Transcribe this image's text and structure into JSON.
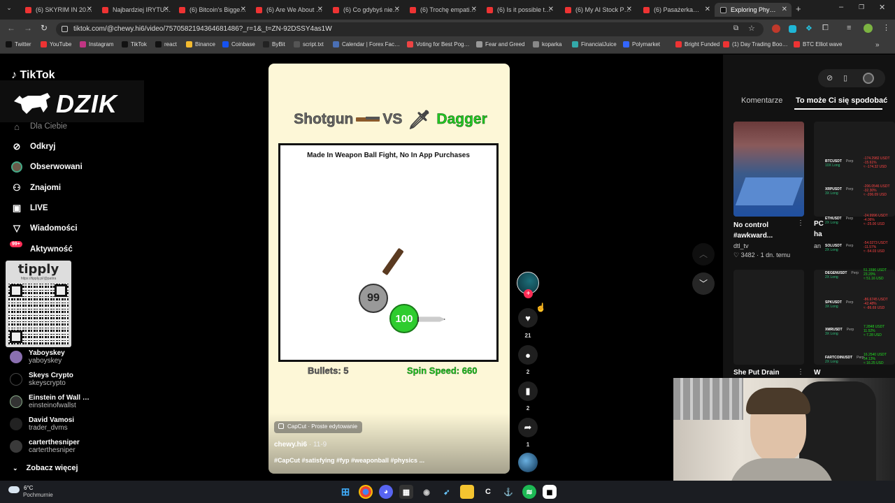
{
  "browser": {
    "tabs": [
      {
        "label": "(6) SKYRIM IN 20…"
      },
      {
        "label": "Najbardziej IRYTU…"
      },
      {
        "label": "(6) Bitcoin's Bigge…"
      },
      {
        "label": "(6) Are We About …"
      },
      {
        "label": "(6) Co gdybyś nie…"
      },
      {
        "label": "(6) Trochę empati…"
      },
      {
        "label": "(6) Is it possible t…"
      },
      {
        "label": "(6) My AI Stock P…"
      },
      {
        "label": "(6) Pasażerka…"
      },
      {
        "label": "Exploring Phy…"
      }
    ],
    "url": "tiktok.com/@chewy.hi6/video/7570582194364681486?_r=1&_t=ZN-92DSSY4as1W",
    "bookmarks": [
      "Twitter",
      "YouTube",
      "Instagram",
      "TikTok",
      "react",
      "Binance",
      "Coinbase",
      "ByBit",
      "script.txt",
      "Calendar | Forex Fac…",
      "Voting for Best Pog…",
      "Fear and Greed",
      "koparka",
      "FinancialJuice",
      "Polymarket",
      "Bright Funded",
      "(1) Day Trading Boo…",
      "BTC Elliot wave"
    ]
  },
  "sidebar": {
    "logo": "TikTok",
    "overlay_logo": "DZIK",
    "nav": [
      {
        "label": "Dla Ciebie"
      },
      {
        "label": "Odkryj"
      },
      {
        "label": "Obserwowani"
      },
      {
        "label": "Znajomi"
      },
      {
        "label": "LIVE"
      },
      {
        "label": "Wiadomości"
      },
      {
        "label": "Aktywność",
        "badge": "99+"
      }
    ],
    "qr_label": "tipply",
    "qr_url": "https://tipply.pl/@patira",
    "following": [
      {
        "name": "Yaboyskey",
        "handle": "yaboyskey"
      },
      {
        "name": "Skeys Crypto",
        "handle": "skeyscrypto"
      },
      {
        "name": "Einstein of Wall …",
        "handle": "einsteinofwallst"
      },
      {
        "name": "David Vamosi",
        "handle": "trader_dvms"
      },
      {
        "name": "carterthesniper",
        "handle": "carterthesniper"
      }
    ],
    "see_more": "Zobacz więcej"
  },
  "video": {
    "title_left": "Shotgun",
    "vs": "VS",
    "title_right": "Dagger",
    "banner": "Made In Weapon Ball Fight, No In App Purchases",
    "ball_gray": "99",
    "ball_green": "100",
    "bullets": "Bullets: 5",
    "spin_speed": "Spin Speed: 660",
    "capcut": "CapCut · Proste edytowanie",
    "author": "chewy.hi6",
    "date": "· 11-9",
    "description": "#CapCut #satisfying #fyp #weaponball #physics ...",
    "likes": "21",
    "comments": "2",
    "saves": "2",
    "shares": "1"
  },
  "right_panel": {
    "tabs": [
      "Komentarze",
      "To może Ci się spodobać"
    ],
    "cards": [
      {
        "title": "No control #awkward...",
        "author": "dtl_tv",
        "likes": "3482",
        "age": "1 dn. temu"
      },
      {
        "title": "She Put Drain"
      }
    ],
    "partial_letters": [
      "PC",
      "ha",
      "an",
      "W"
    ],
    "crypto": [
      {
        "sym": "BTCUSDT",
        "lev": "10X Long",
        "v1": "-174.2982 USDT",
        "v2": "-15.61%",
        "v3": "≈ -174.32 USD"
      },
      {
        "sym": "XRPUSDT",
        "lev": "3X Long",
        "v1": "-206.0546 USDT",
        "v2": "-32.30%",
        "v3": "≈ -206.09 USD"
      },
      {
        "sym": "ETHUSDT",
        "lev": "2X Long",
        "v1": "-24.9996 USDT",
        "v2": "-4.06%",
        "v3": "≈ -25.00 USD"
      },
      {
        "sym": "SOLUSDT",
        "lev": "2X Long",
        "v1": "-54.0273 USDT",
        "v2": "-11.57%",
        "v3": "≈ -54.03 USD"
      },
      {
        "sym": "DEGENUSDT",
        "lev": "2X Long",
        "v1": "51.1596 USDT",
        "v2": "23.20%",
        "v3": "≈ 51.16 USD"
      },
      {
        "sym": "SPKUSDT",
        "lev": "3X Long",
        "v1": "-86.6745 USDT",
        "v2": "-42.48%",
        "v3": "≈ -86.69 USD"
      },
      {
        "sym": "XMRUSDT",
        "lev": "3X Long",
        "v1": "7.2848 USDT",
        "v2": "11.52%",
        "v3": "≈ 7.28 USD"
      },
      {
        "sym": "FARTCOINUSDT",
        "lev": "2X Long",
        "v1": "16.2540 USDT",
        "v2": "54.13%",
        "v3": "≈ 16.25 USD"
      }
    ],
    "perp": "Perp"
  },
  "taskbar": {
    "temp": "6°C",
    "weather": "Pochmurnie"
  },
  "colors": {
    "green": "#22dd22",
    "red": "#ff4444",
    "tiktok_red": "#fe2c55",
    "video_bg": "#fdf7d7"
  }
}
